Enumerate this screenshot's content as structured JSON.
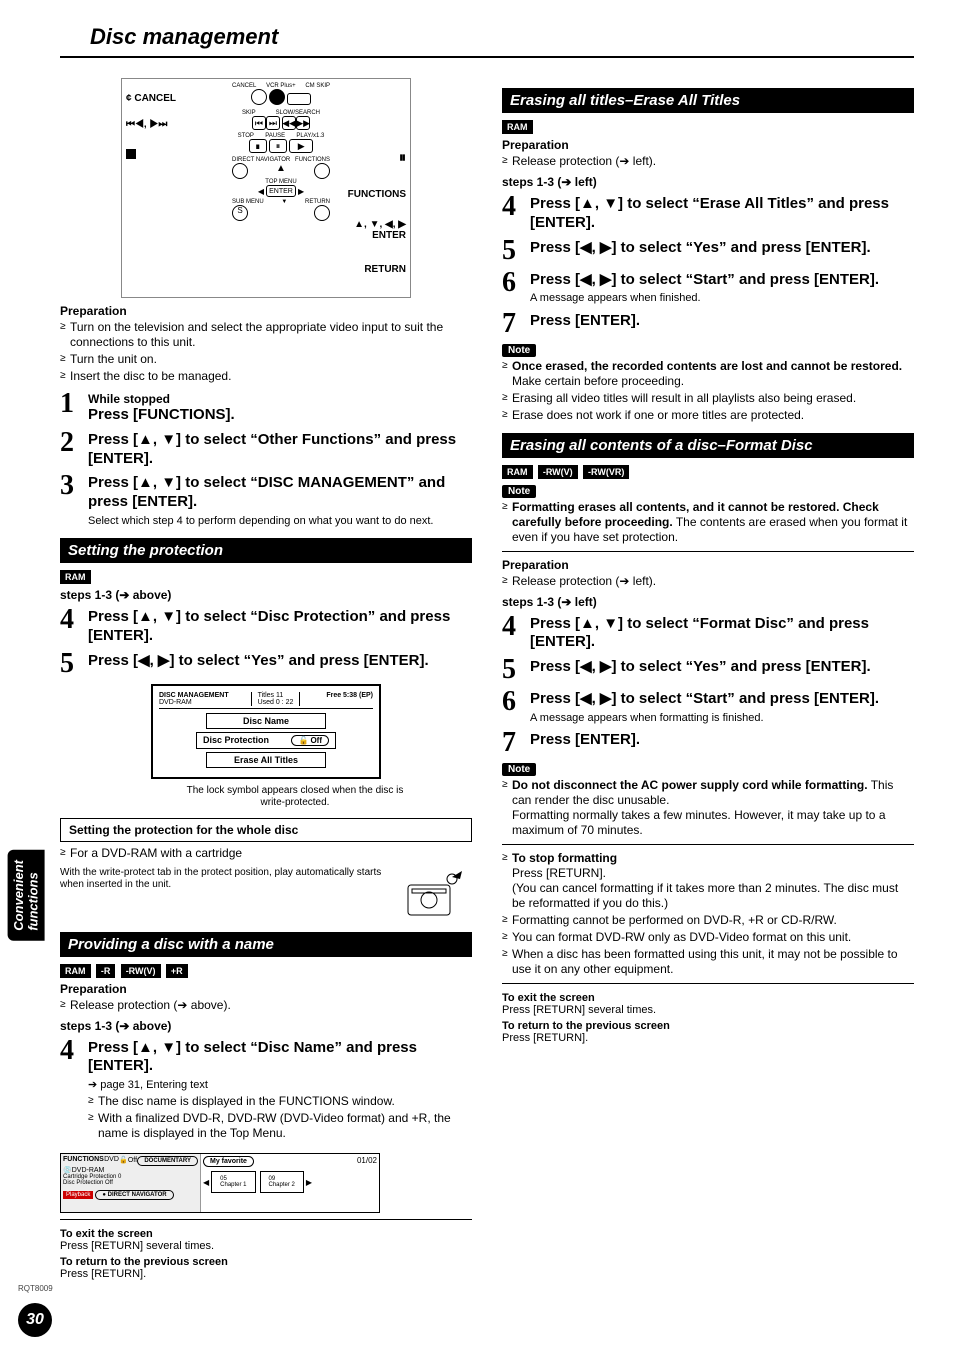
{
  "page": {
    "title": "Disc management",
    "sideTab": "Convenient\nfunctions",
    "pageNumber": "30",
    "docCode": "RQT8009"
  },
  "remote": {
    "cancel": "CANCEL",
    "transport1": "⏮, ⏭",
    "stopSym": "∎",
    "pauseSym": "⏸",
    "functions": "FUNCTIONS",
    "arrowsEnter": "▲, ▼, ◀, ▶\nENTER",
    "return": "RETURN",
    "labels": {
      "cancel": "CANCEL",
      "vcr": "VCR Plus+",
      "cm": "CM SKIP",
      "skip": "SKIP",
      "slow": "SLOW/SEARCH",
      "stop": "STOP",
      "pause": "PAUSE",
      "play": "PLAY/x1.3",
      "dn": "DIRECT NAVIGATOR",
      "fn": "FUNCTIONS",
      "tm": "TOP MENU",
      "enter": "ENTER",
      "sm": "SUB MENU",
      "ret": "RETURN"
    }
  },
  "prepTop": {
    "head": "Preparation",
    "b1": "Turn on the television and select the appropriate video input to suit the connections to this unit.",
    "b2": "Turn the unit on.",
    "b3": "Insert the disc to be managed."
  },
  "intro": {
    "s1pre": "While stopped",
    "s1": "Press [FUNCTIONS].",
    "s2": "Press [▲, ▼] to select “Other Functions” and press [ENTER].",
    "s3": "Press [▲, ▼] to select “DISC MANAGEMENT” and press [ENTER].",
    "s3sub": "Select which step 4 to perform depending on what you want to do next."
  },
  "protect": {
    "title": "Setting the protection",
    "badge1": "RAM",
    "stepsRef": "steps 1-3 (➔ above)",
    "s4": "Press [▲, ▼] to select “Disc Protection” and press [ENTER].",
    "s5": "Press [◀, ▶] to select “Yes” and press [ENTER].",
    "menu": {
      "header": "DISC MANAGEMENT",
      "media": "DVD-RAM",
      "titles": "Titles   11",
      "used": "Used   0 : 22",
      "free": "Free  5:38 (EP)",
      "m1": "Disc Name",
      "m2": "Disc Protection",
      "m2val": "Off",
      "m3": "Erase All Titles"
    },
    "lockNote": "The lock symbol appears closed when the disc is write-protected.",
    "boxed": "Setting the protection for the whole disc",
    "cartLine": "For a DVD-RAM with a cartridge",
    "cartText": "With the write-protect tab in the protect position, play automatically starts when inserted in the unit."
  },
  "naming": {
    "title": "Providing a disc with a name",
    "badges": [
      "RAM",
      "-R",
      "-RW(V)",
      "+R"
    ],
    "prepHead": "Preparation",
    "prepB1": "Release protection (➔ above).",
    "stepsRef": "steps 1-3 (➔ above)",
    "s4": "Press [▲, ▼] to select “Disc Name” and press [ENTER].",
    "s4sub1": "➔ page 31, Entering text",
    "s4b1": "The disc name is displayed in the FUNCTIONS window.",
    "s4b2": "With a finalized DVD-R, DVD-RW (DVD-Video format) and +R, the name is displayed in the Top Menu.",
    "tv": {
      "func": "FUNCTIONS",
      "dvd": "DVD",
      "off": "Off",
      "doc": "DOCUMENTARY",
      "media": "DVD-RAM",
      "cprot": "Cartridge Protection  0",
      "dprot": "Disc Protection  Off",
      "pb": "Playback",
      "dn": "DIRECT NAVIGATOR",
      "fav": "My favorite",
      "pg": "01/02",
      "c1": "05\nChapter 1",
      "c2": "09\nChapter 2"
    }
  },
  "footerLeft": {
    "exitHead": "To exit the screen",
    "exitBody": "Press [RETURN] several times.",
    "prevHead": "To return to the previous screen",
    "prevBody": "Press [RETURN]."
  },
  "eraseAll": {
    "title": "Erasing all titles–Erase All Titles",
    "badge1": "RAM",
    "prepHead": "Preparation",
    "prepB1": "Release protection (➔ left).",
    "stepsRef": "steps 1-3 (➔ left)",
    "s4": "Press [▲, ▼] to select “Erase All Titles” and press [ENTER].",
    "s5": "Press [◀, ▶] to select “Yes” and press [ENTER].",
    "s6": "Press [◀, ▶] to select “Start” and press [ENTER].",
    "s6sub": "A message appears when finished.",
    "s7": "Press [ENTER].",
    "noteLabel": "Note",
    "n1a": "Once erased, the recorded contents are lost and cannot be restored.",
    "n1b": " Make certain before proceeding.",
    "n2": "Erasing all video titles will result in all playlists also being erased.",
    "n3": "Erase does not work if one or more titles are protected."
  },
  "format": {
    "title": "Erasing all contents of a disc–Format Disc",
    "badges": [
      "RAM",
      "-RW(V)",
      "-RW(VR)"
    ],
    "noteLabel": "Note",
    "warn1a": "Formatting erases all contents, and it cannot be restored. Check carefully before proceeding.",
    "warn1b": " The contents are erased when you format it even if you have set protection.",
    "prepHead": "Preparation",
    "prepB1": "Release protection (➔ left).",
    "stepsRef": "steps 1-3 (➔ left)",
    "s4": "Press [▲, ▼] to select “Format Disc” and press [ENTER].",
    "s5": "Press [◀, ▶] to select “Yes” and press [ENTER].",
    "s6": "Press [◀, ▶] to select “Start” and press [ENTER].",
    "s6sub": "A message appears when formatting is finished.",
    "s7": "Press [ENTER].",
    "noteLabel2": "Note",
    "n1a": "Do not disconnect the AC power supply cord while formatting.",
    "n1b": " This can render the disc unusable.",
    "n1c": "Formatting normally takes a few minutes. However, it may take up to a maximum of 70 minutes.",
    "n2head": "To stop formatting",
    "n2a": "Press [RETURN].",
    "n2b": "(You can cancel formatting if it takes more than 2 minutes. The disc must be reformatted if you do this.)",
    "n3": "Formatting cannot be performed on DVD-R, +R or CD-R/RW.",
    "n4": "You can format DVD-RW only as DVD-Video format on this unit.",
    "n5": "When a disc has been formatted using this unit, it may not be possible to use it on any other equipment."
  },
  "footerRight": {
    "exitHead": "To exit the screen",
    "exitBody": "Press [RETURN] several times.",
    "prevHead": "To return to the previous screen",
    "prevBody": "Press [RETURN]."
  }
}
